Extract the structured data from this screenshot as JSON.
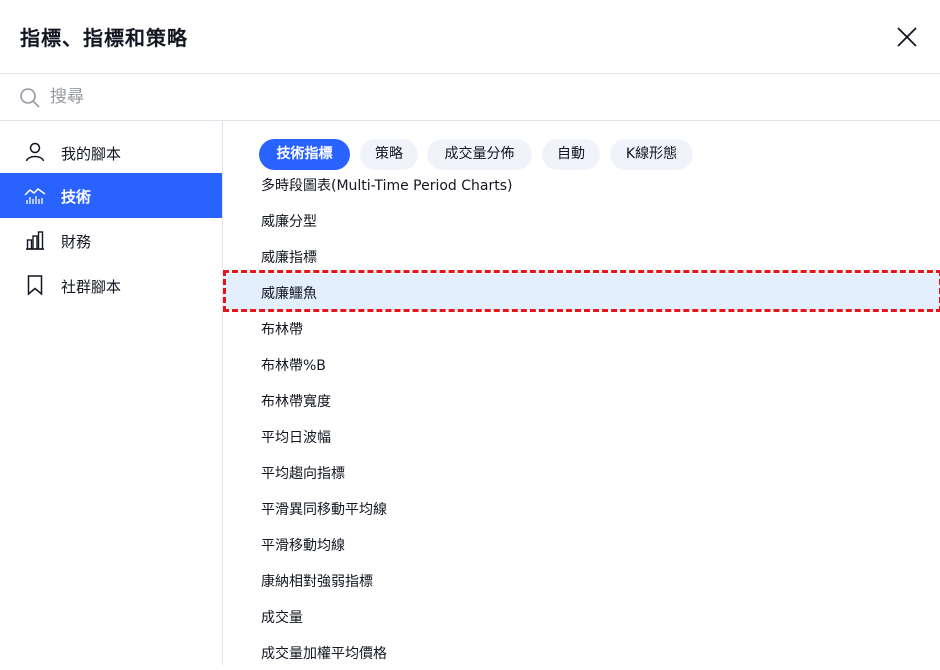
{
  "dialog": {
    "title": "指標、指標和策略"
  },
  "search": {
    "placeholder": "搜尋",
    "value": ""
  },
  "sidebar": {
    "items": [
      {
        "label": "我的腳本",
        "icon": "user-icon",
        "active": false
      },
      {
        "label": "技術",
        "icon": "chart-icon",
        "active": true
      },
      {
        "label": "財務",
        "icon": "bar-chart-icon",
        "active": false
      },
      {
        "label": "社群腳本",
        "icon": "bookmark-icon",
        "active": false
      }
    ]
  },
  "tabs": [
    {
      "label": "技術指標",
      "active": true
    },
    {
      "label": "策略",
      "active": false
    },
    {
      "label": "成交量分佈",
      "active": false
    },
    {
      "label": "自動",
      "active": false
    },
    {
      "label": "K線形態",
      "active": false
    }
  ],
  "indicators": [
    {
      "label": "多時段圖表(Multi-Time Period Charts)"
    },
    {
      "label": "威廉分型"
    },
    {
      "label": "威廉指標"
    },
    {
      "label": "威廉鱷魚",
      "highlighted": true
    },
    {
      "label": "布林帶"
    },
    {
      "label": "布林帶%B"
    },
    {
      "label": "布林帶寬度"
    },
    {
      "label": "平均日波幅"
    },
    {
      "label": "平均趨向指標"
    },
    {
      "label": "平滑異同移動平均線"
    },
    {
      "label": "平滑移動均線"
    },
    {
      "label": "康納相對強弱指標"
    },
    {
      "label": "成交量"
    },
    {
      "label": "成交量加權平均價格"
    }
  ],
  "colors": {
    "accent": "#2962ff",
    "highlight_row": "#e3effd",
    "annotation_border": "#e8141a"
  }
}
